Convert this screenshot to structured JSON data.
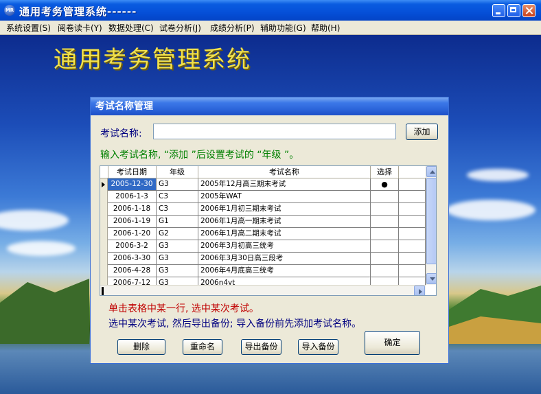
{
  "window": {
    "title": "通用考务管理系统------",
    "icon_text": "MR"
  },
  "menu": [
    "系统设置(S)",
    "阅卷读卡(Y)",
    "数据处理(C)",
    "试卷分析(J)",
    "成绩分析(P)",
    "辅助功能(G)",
    "帮助(H)"
  ],
  "banner_title": "通用考务管理系统",
  "dialog": {
    "title": "考试名称管理",
    "name_label": "考试名称:",
    "name_value": "",
    "add_label": "添加",
    "hint_add": "输入考试名称, “添加 ”后设置考试的 “年级 ”。",
    "columns": [
      "考试日期",
      "年级",
      "考试名称",
      "选择"
    ],
    "rows": [
      {
        "date": "2005-12-30",
        "grade": "G3",
        "name": "2005年12月高三期末考试",
        "select": "●"
      },
      {
        "date": "2006-1-3",
        "grade": "C3",
        "name": "2005年WAT",
        "select": ""
      },
      {
        "date": "2006-1-18",
        "grade": "C3",
        "name": "2006年1月初三期末考试",
        "select": ""
      },
      {
        "date": "2006-1-19",
        "grade": "G1",
        "name": "2006年1月高一期末考试",
        "select": ""
      },
      {
        "date": "2006-1-20",
        "grade": "G2",
        "name": "2006年1月高二期末考试",
        "select": ""
      },
      {
        "date": "2006-3-2",
        "grade": "G3",
        "name": "2006年3月初高三统考",
        "select": ""
      },
      {
        "date": "2006-3-30",
        "grade": "G3",
        "name": "2006年3月30日高三段考",
        "select": ""
      },
      {
        "date": "2006-4-28",
        "grade": "G3",
        "name": "2006年4月底高三统考",
        "select": ""
      },
      {
        "date": "2006-7-12",
        "grade": "G3",
        "name": "2006n4yt",
        "select": ""
      }
    ],
    "hint_select": "单击表格中某一行, 选中某次考试。",
    "hint_backup": "选中某次考试, 然后导出备份; 导入备份前先添加考试名称。",
    "buttons": {
      "delete": "删除",
      "rename": "重命名",
      "export": "导出备份",
      "import": "导入备份",
      "ok": "确定"
    }
  }
}
